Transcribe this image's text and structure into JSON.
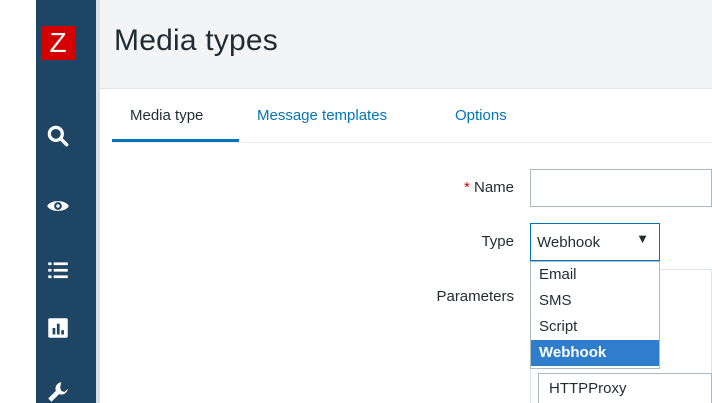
{
  "sidebar": {
    "logo": "Z",
    "icons": [
      "search-icon",
      "eye-icon",
      "list-icon",
      "chart-icon",
      "wrench-icon"
    ],
    "colors": {
      "background": "#1f4564",
      "logo": "#d40000"
    }
  },
  "header": {
    "title": "Media types"
  },
  "tabs": [
    {
      "label": "Media type",
      "active": true
    },
    {
      "label": "Message templates",
      "active": false
    },
    {
      "label": "Options",
      "active": false
    }
  ],
  "form": {
    "name": {
      "required_mark": "*",
      "label": "Name",
      "value": ""
    },
    "type": {
      "label": "Type",
      "value": "Webhook",
      "arrow": "▼",
      "options": [
        "Email",
        "SMS",
        "Script",
        "Webhook"
      ],
      "selected_index": 3
    },
    "parameters": {
      "label": "Parameters",
      "first_param_value": "HTTPProxy"
    }
  },
  "colors": {
    "accent": "#0275b8",
    "selected_option": "#2e7ecb",
    "required": "#d40000"
  }
}
